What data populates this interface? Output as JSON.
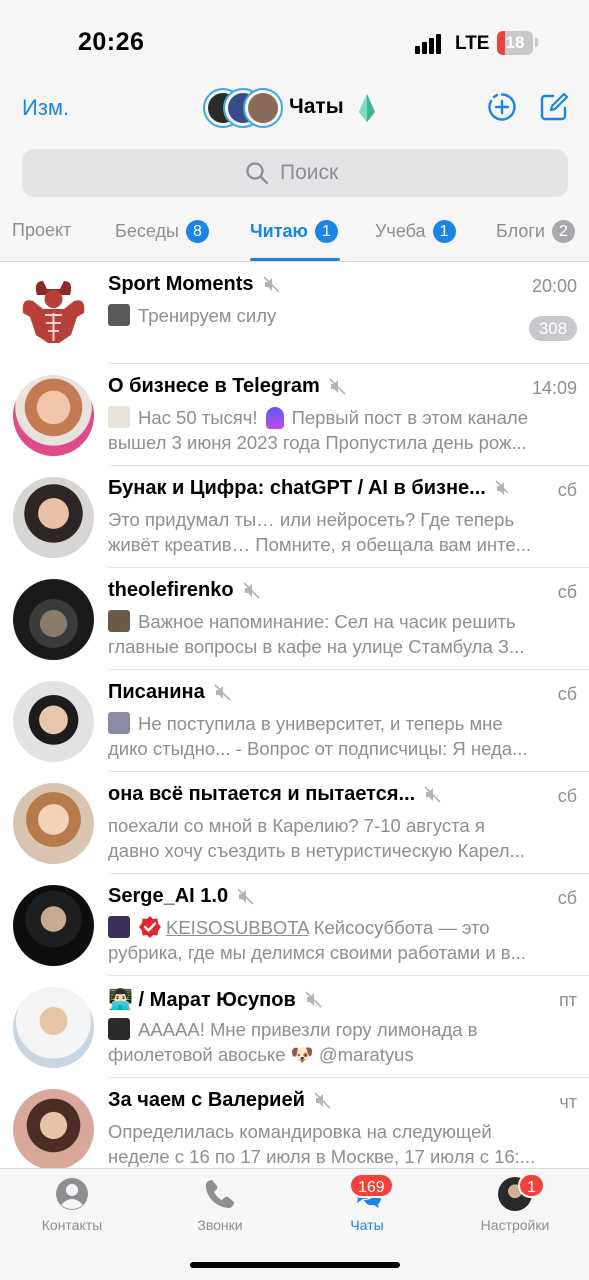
{
  "status_bar": {
    "time": "20:26",
    "network": "LTE",
    "battery": "18"
  },
  "header": {
    "edit_label": "Изм.",
    "title": "Чаты",
    "search_placeholder": "Поиск"
  },
  "folders": [
    {
      "label": "Проект",
      "count": ""
    },
    {
      "label": "Беседы",
      "count": "8"
    },
    {
      "label": "Читаю",
      "count": "1"
    },
    {
      "label": "Учеба",
      "count": "1"
    },
    {
      "label": "Блоги",
      "count": "2"
    }
  ],
  "active_folder": "Читаю",
  "colors": {
    "accent": "#1a85e6",
    "muted": "#8e8e93",
    "badge_red": "#f2413a",
    "muted_badge": "#c7c7cc"
  },
  "chats": [
    {
      "name": "Sport Moments",
      "time": "20:00",
      "line1": "Тренируем силу",
      "line2": "",
      "unread": "308",
      "icon": "muscle-mascot-icon"
    },
    {
      "name": "О бизнесе в Telegram",
      "time": "14:09",
      "line1_a": "Нас 50 тысяч!",
      "line1_b": "Первый пост в этом канале",
      "line2": "вышел 3 июня 2023 года Пропустила день рож...",
      "unread": ""
    },
    {
      "name": "Бунак и Цифра: chatGPT / AI в бизне...",
      "time": "сб",
      "line1": "Это придумал ты… или нейросеть? Где теперь",
      "line2": "живёт креатив… Помните, я обещала вам инте...",
      "unread": ""
    },
    {
      "name": "theolefirenko",
      "time": "сб",
      "line1": "Важное напоминание: Сел на часик решить",
      "line2": "главные вопросы в кафе на улице Стамбула  З...",
      "unread": ""
    },
    {
      "name": "Писанина",
      "time": "сб",
      "line1": "Не поступила в университет, и теперь мне",
      "line2": "дико стыдно... - Вопрос от подписчицы: Я неда...",
      "unread": ""
    },
    {
      "name": "она всё пытается и пытается...",
      "time": "сб",
      "line1": "поехали со мной в Карелию? 7-10 августа я",
      "line2": "давно хочу съездить в нетуристическую Карел...",
      "unread": ""
    },
    {
      "name": "Serge_AI 1.0",
      "time": "сб",
      "line1_link": "KEISOSUBBOTA",
      "line1": "Кейсосуббота —  это",
      "line2": "рубрика, где мы делимся своими работами и в...",
      "unread": ""
    },
    {
      "name": "👨🏻‍💻 / Марат Юсупов",
      "time": "пт",
      "line1": "АААAA! Мне привезли гору лимонада в",
      "line2_a": "фиолетовой авоське",
      "line2_emoji": "🐶",
      "line2_b": "@maratyus",
      "unread": ""
    },
    {
      "name": "За чаем с Валерией",
      "time": "чт",
      "line1": "Определилась командировка на следующей",
      "line2": "неделе с 16 по 17 июля в Москве, 17 июля с 16:...",
      "unread": ""
    }
  ],
  "tabbar": {
    "contacts": "Контакты",
    "calls": "Звонки",
    "chats": "Чаты",
    "chats_badge": "169",
    "settings": "Настройки",
    "settings_badge": "1"
  }
}
